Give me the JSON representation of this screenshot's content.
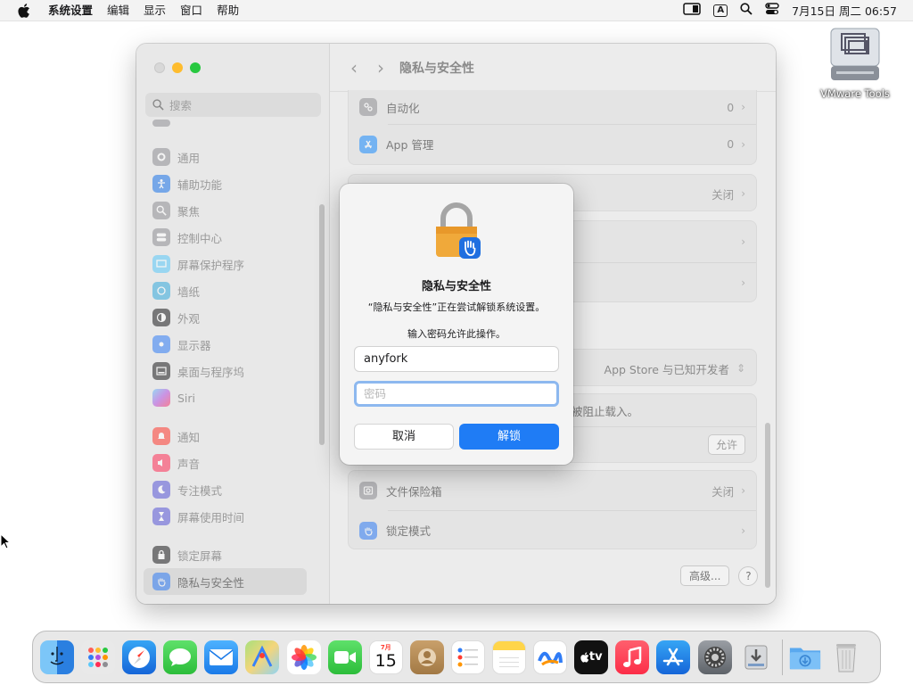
{
  "menubar": {
    "apple_icon": "apple-icon",
    "app_name": "系统设置",
    "items": [
      "编辑",
      "显示",
      "窗口",
      "帮助"
    ],
    "input_indicator": "A",
    "datetime": "7月15日 周二 06:57"
  },
  "desktop": {
    "icon_label": "VMware Tools"
  },
  "window": {
    "title": "隐私与安全性",
    "search_placeholder": "搜索",
    "sidebar_items": [
      {
        "label": "通用",
        "icon": "gear-icon",
        "color": "#8e8e93"
      },
      {
        "label": "辅助功能",
        "icon": "accessibility-icon",
        "color": "#1a73e8"
      },
      {
        "label": "聚焦",
        "icon": "magnifier-icon",
        "color": "#8e8e93"
      },
      {
        "label": "控制中心",
        "icon": "control-center-icon",
        "color": "#8e8e93"
      },
      {
        "label": "屏幕保护程序",
        "icon": "screensaver-icon",
        "color": "#5ac8fa"
      },
      {
        "label": "墙纸",
        "icon": "wallpaper-icon",
        "color": "#34aadc"
      },
      {
        "label": "外观",
        "icon": "appearance-icon",
        "color": "#1c1c1e"
      },
      {
        "label": "显示器",
        "icon": "display-icon",
        "color": "#2f7cf6"
      },
      {
        "label": "桌面与程序坞",
        "icon": "dock-icon",
        "color": "#1c1c1e"
      },
      {
        "label": "Siri",
        "icon": "siri-icon",
        "color": "#b14ee0"
      },
      {
        "label": "通知",
        "icon": "bell-icon",
        "color": "#ff3b30"
      },
      {
        "label": "声音",
        "icon": "speaker-icon",
        "color": "#ff2d55"
      },
      {
        "label": "专注模式",
        "icon": "moon-icon",
        "color": "#5856d6"
      },
      {
        "label": "屏幕使用时间",
        "icon": "hourglass-icon",
        "color": "#5856d6"
      },
      {
        "label": "锁定屏幕",
        "icon": "lock-icon",
        "color": "#1c1c1e"
      },
      {
        "label": "隐私与安全性",
        "icon": "hand-icon",
        "color": "#2f7cf6"
      }
    ],
    "rows": {
      "automation": {
        "label": "自动化",
        "value": "0"
      },
      "app_management": {
        "label": "App 管理",
        "value": "0"
      },
      "row_off_value": "关闭",
      "app_source": "App Store 与已知开发者",
      "blocked_text": "被阻止载入。",
      "allow_button": "允许",
      "filevault": {
        "label": "文件保险箱",
        "value": "关闭"
      },
      "lockdown": {
        "label": "锁定模式"
      },
      "advanced_button": "高级...",
      "help_button": "?"
    }
  },
  "dialog": {
    "title": "隐私与安全性",
    "message": "“隐私与安全性”正在尝试解锁系统设置。",
    "prompt": "输入密码允许此操作。",
    "username": "anyfork",
    "password_placeholder": "密码",
    "cancel_label": "取消",
    "unlock_label": "解锁"
  },
  "dock": {
    "calendar_month": "7月",
    "calendar_day": "15",
    "tv_label": "tv",
    "apps": [
      "Finder",
      "Launchpad",
      "Safari",
      "Messages",
      "Mail",
      "Maps",
      "Photos",
      "FaceTime",
      "Calendar",
      "Contacts",
      "Reminders",
      "Notes",
      "Freeform",
      "TV",
      "Music",
      "App Store",
      "System Settings",
      "Installer",
      "Downloads",
      "Trash"
    ]
  }
}
